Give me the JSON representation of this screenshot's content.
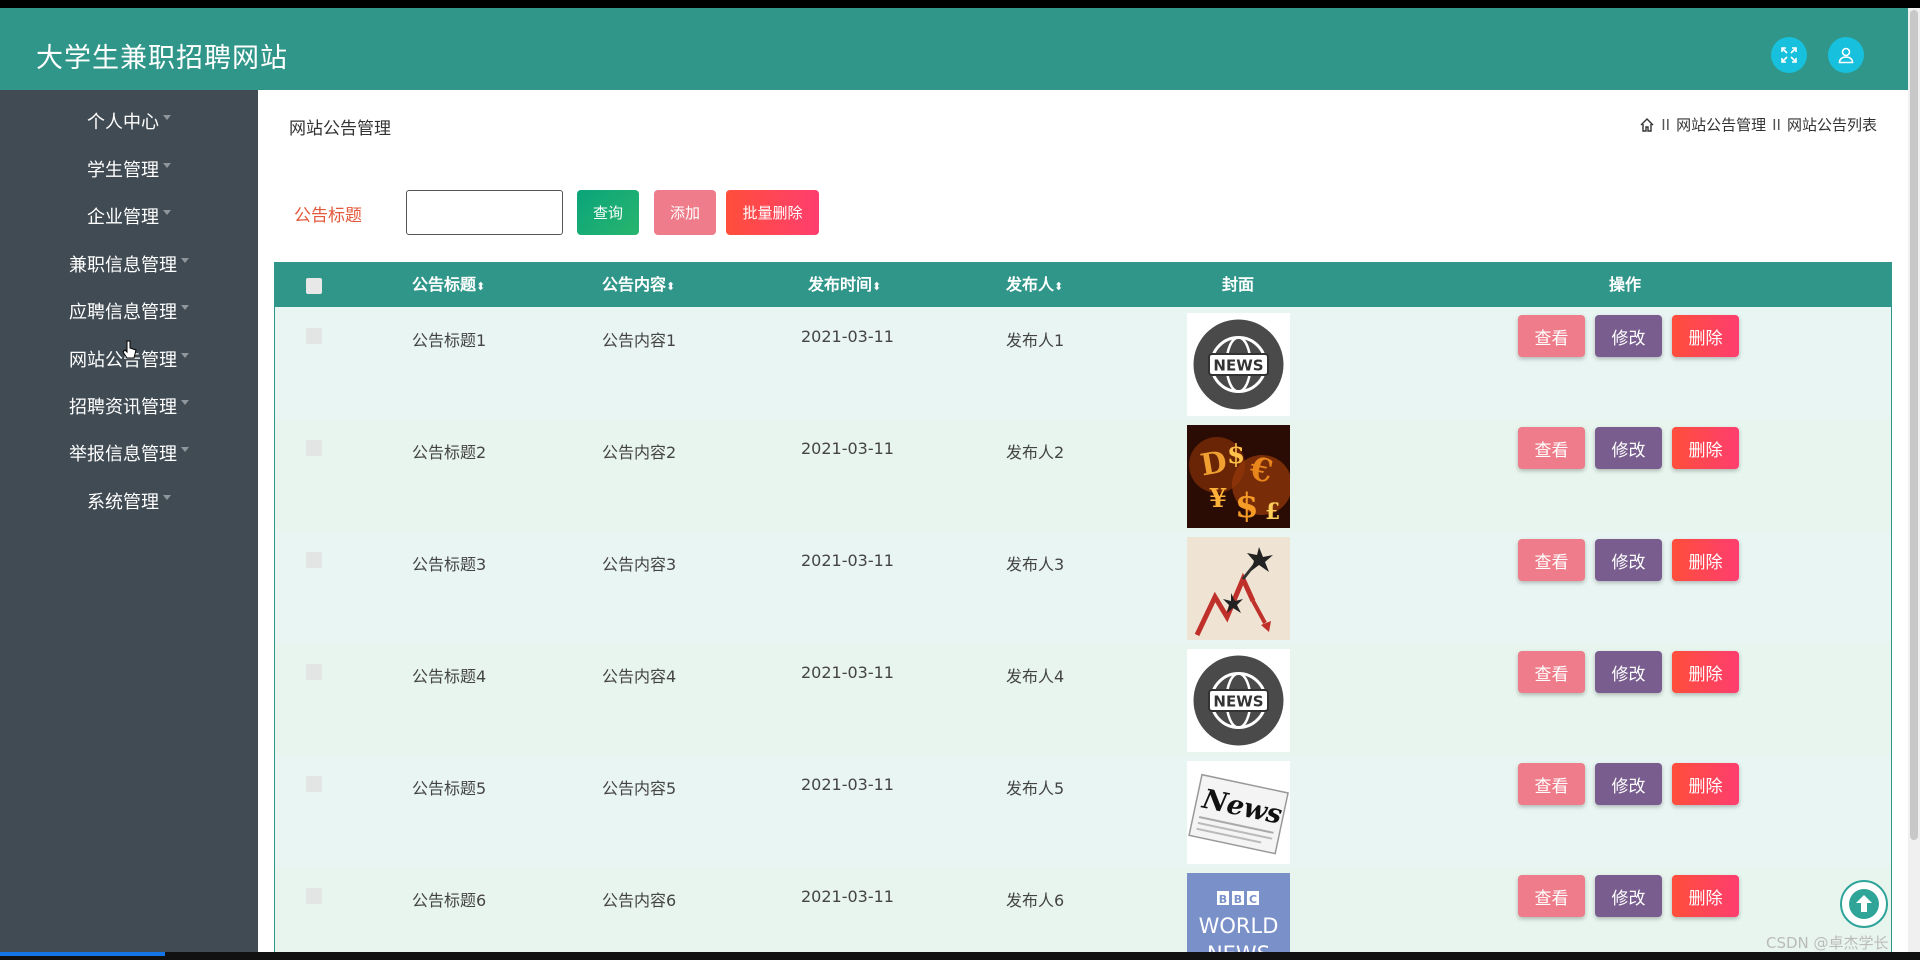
{
  "header": {
    "site_title": "大学生兼职招聘网站",
    "icons": [
      "fullscreen-icon",
      "user-icon"
    ]
  },
  "sidebar": {
    "items": [
      {
        "label": "个人中心"
      },
      {
        "label": "学生管理"
      },
      {
        "label": "企业管理"
      },
      {
        "label": "兼职信息管理"
      },
      {
        "label": "应聘信息管理"
      },
      {
        "label": "网站公告管理"
      },
      {
        "label": "招聘资讯管理"
      },
      {
        "label": "举报信息管理"
      },
      {
        "label": "系统管理"
      }
    ]
  },
  "main": {
    "page_title": "网站公告管理",
    "breadcrumb": {
      "sep": "II",
      "level1": "网站公告管理",
      "level2": "网站公告列表"
    },
    "search": {
      "label": "公告标题",
      "value": "",
      "placeholder": ""
    },
    "buttons": {
      "query": "查询",
      "add": "添加",
      "batch_delete": "批量删除"
    },
    "table": {
      "headers": {
        "title": "公告标题",
        "content": "公告内容",
        "time": "发布时间",
        "publisher": "发布人",
        "cover": "封面",
        "actions": "操作"
      },
      "sort_mark": "⬍",
      "action_labels": {
        "view": "查看",
        "edit": "修改",
        "delete": "删除"
      },
      "rows": [
        {
          "title": "公告标题1",
          "content": "公告内容1",
          "time": "2021-03-11",
          "publisher": "发布人1",
          "cover": "news-globe"
        },
        {
          "title": "公告标题2",
          "content": "公告内容2",
          "time": "2021-03-11",
          "publisher": "发布人2",
          "cover": "money"
        },
        {
          "title": "公告标题3",
          "content": "公告内容3",
          "time": "2021-03-11",
          "publisher": "发布人3",
          "cover": "chart-arrows"
        },
        {
          "title": "公告标题4",
          "content": "公告内容4",
          "time": "2021-03-11",
          "publisher": "发布人4",
          "cover": "news-globe"
        },
        {
          "title": "公告标题5",
          "content": "公告内容5",
          "time": "2021-03-11",
          "publisher": "发布人5",
          "cover": "newspaper"
        },
        {
          "title": "公告标题6",
          "content": "公告内容6",
          "time": "2021-03-11",
          "publisher": "发布人6",
          "cover": "bbc-world-news"
        }
      ]
    },
    "cover_text": {
      "news": "NEWS",
      "news_paper": "News",
      "bbc_letters": [
        "B",
        "B",
        "C"
      ],
      "world": "WORLD",
      "news_upper": "NEWS"
    }
  },
  "watermark": "CSDN @卓杰学长",
  "colors": {
    "header": "#31968a",
    "sidebar": "#404b53",
    "accent": "#17c0dc",
    "label": "#e3583a"
  }
}
